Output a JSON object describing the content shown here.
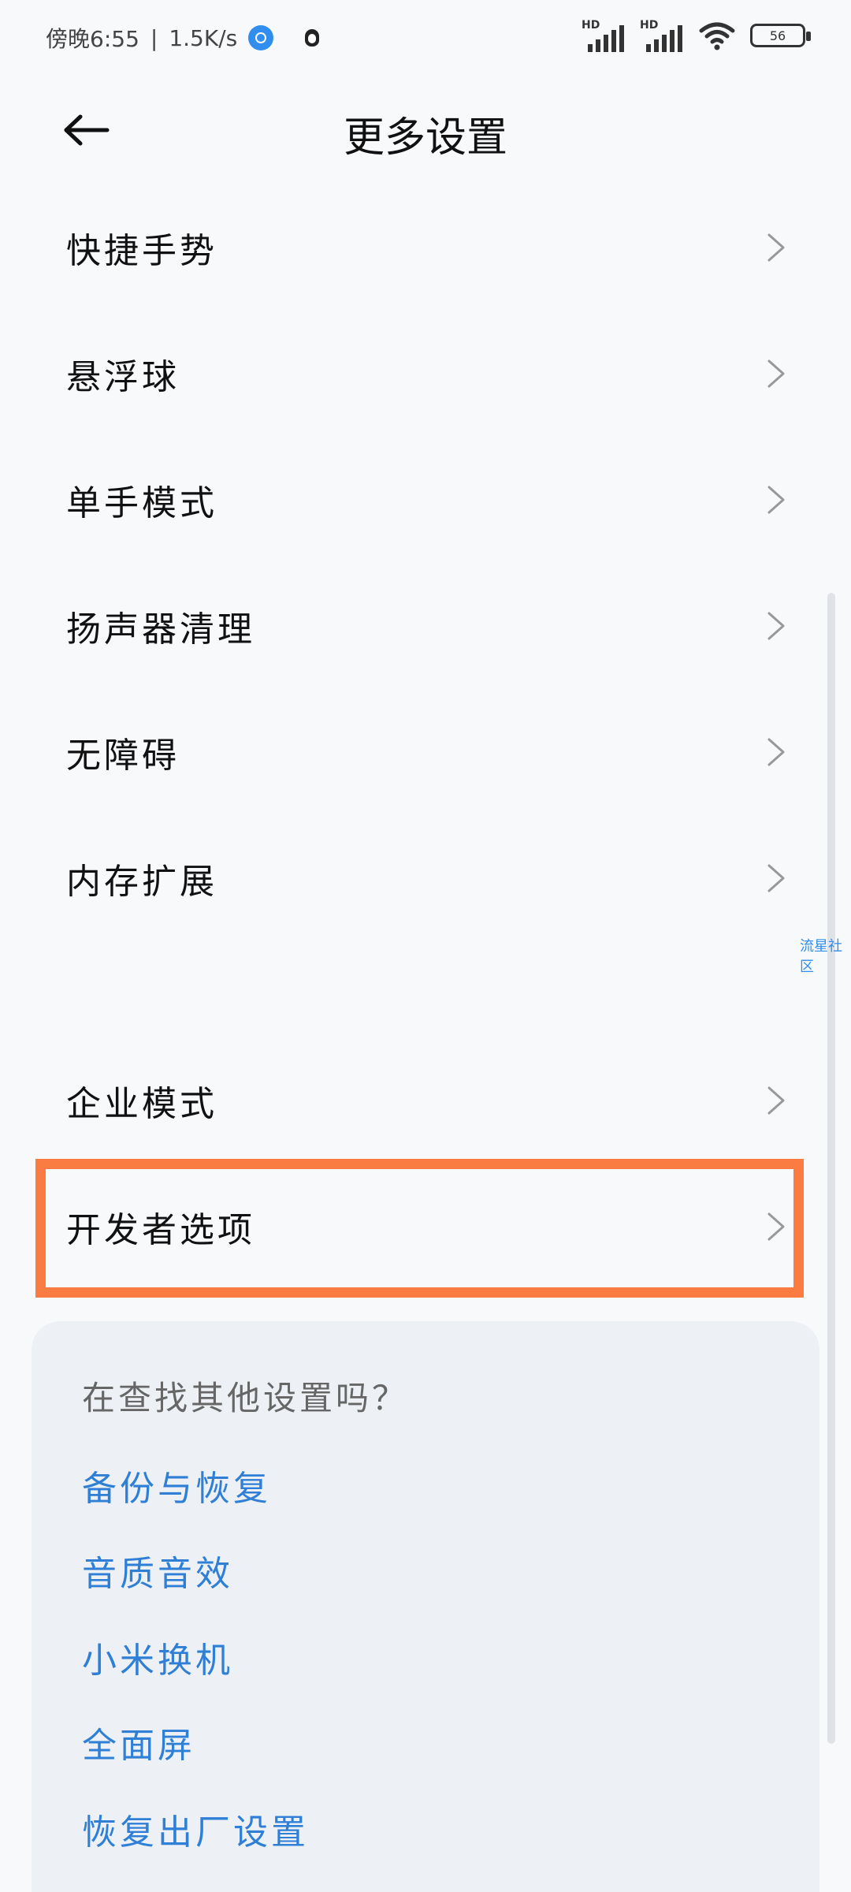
{
  "status_bar": {
    "time": "傍晚6:55",
    "separator": "|",
    "net_speed": "1.5K/s",
    "network_label_1": "HD",
    "network_label_2": "HD",
    "battery_level": "56"
  },
  "header": {
    "title": "更多设置"
  },
  "list": {
    "items": [
      {
        "label": "快捷手势"
      },
      {
        "label": "悬浮球"
      },
      {
        "label": "单手模式"
      },
      {
        "label": "扬声器清理"
      },
      {
        "label": "无障碍"
      },
      {
        "label": "内存扩展"
      },
      {
        "label": "企业模式"
      },
      {
        "label": "开发者选项"
      }
    ]
  },
  "watermark": "流星社区",
  "suggestions": {
    "title": "在查找其他设置吗？",
    "links": [
      {
        "label": "备份与恢复"
      },
      {
        "label": "音质音效"
      },
      {
        "label": "小米换机"
      },
      {
        "label": "全面屏"
      },
      {
        "label": "恢复出厂设置"
      }
    ]
  },
  "colors": {
    "highlight": "#fb7c43",
    "link": "#2f7fd6",
    "background": "#f8f9fb"
  }
}
